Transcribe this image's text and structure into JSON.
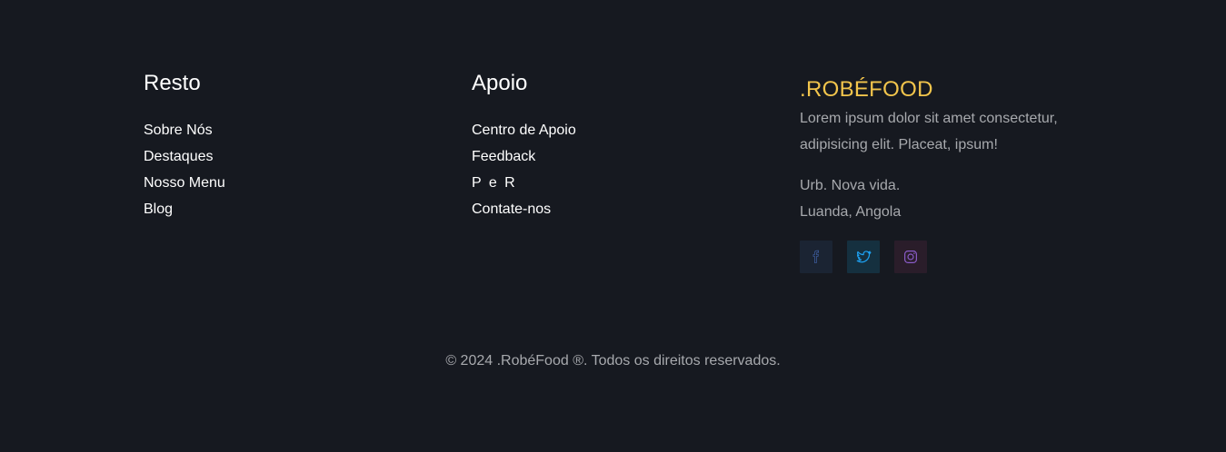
{
  "columns": {
    "resto": {
      "title": "Resto",
      "links": [
        "Sobre Nós",
        "Destaques",
        "Nosso Menu",
        "Blog"
      ]
    },
    "apoio": {
      "title": "Apoio",
      "links": [
        "Centro de Apoio",
        "Feedback",
        "P e R",
        "Contate-nos"
      ]
    }
  },
  "brand": {
    "name": ".ROBÉFOOD",
    "color": "#f2c54c",
    "description": "Lorem ipsum dolor sit amet consectetur, adipisicing elit. Placeat, ipsum!",
    "address_line1": "Urb. Nova vida.",
    "address_line2": "Luanda, Angola"
  },
  "socials": [
    {
      "icon": "facebook-icon",
      "color": "#3b5998"
    },
    {
      "icon": "twitter-icon",
      "color": "#1da1f2"
    },
    {
      "icon": "instagram-icon",
      "color": "#8a5cc8"
    }
  ],
  "copyright": "© 2024 .RobéFood ®. Todos os direitos reservados."
}
